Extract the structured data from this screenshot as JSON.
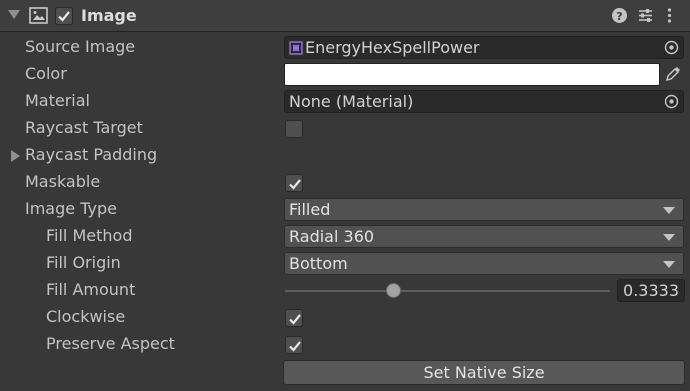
{
  "component": {
    "title": "Image",
    "enabled": true,
    "icons": [
      "help-icon",
      "presets-icon",
      "more-options-icon"
    ]
  },
  "properties": {
    "source_image": {
      "label": "Source Image",
      "value": "EnergyHexSpellPower"
    },
    "color": {
      "label": "Color",
      "value": "#ffffff"
    },
    "material": {
      "label": "Material",
      "value": "None (Material)"
    },
    "raycast_target": {
      "label": "Raycast Target",
      "checked": false
    },
    "raycast_padding": {
      "label": "Raycast Padding",
      "expanded": false
    },
    "maskable": {
      "label": "Maskable",
      "checked": true
    },
    "image_type": {
      "label": "Image Type",
      "value": "Filled"
    },
    "fill_method": {
      "label": "Fill Method",
      "value": "Radial 360"
    },
    "fill_origin": {
      "label": "Fill Origin",
      "value": "Bottom"
    },
    "fill_amount": {
      "label": "Fill Amount",
      "value": "0.3333",
      "fraction": 0.3333
    },
    "clockwise": {
      "label": "Clockwise",
      "checked": true
    },
    "preserve_aspect": {
      "label": "Preserve Aspect",
      "checked": true
    }
  },
  "buttons": {
    "set_native_size": "Set Native Size"
  },
  "colors": {
    "background": "#383838",
    "header": "#3e3e3e",
    "field": "#2a2a2a",
    "dropdown": "#515151",
    "sprite_accent": "#8c6fd8"
  }
}
